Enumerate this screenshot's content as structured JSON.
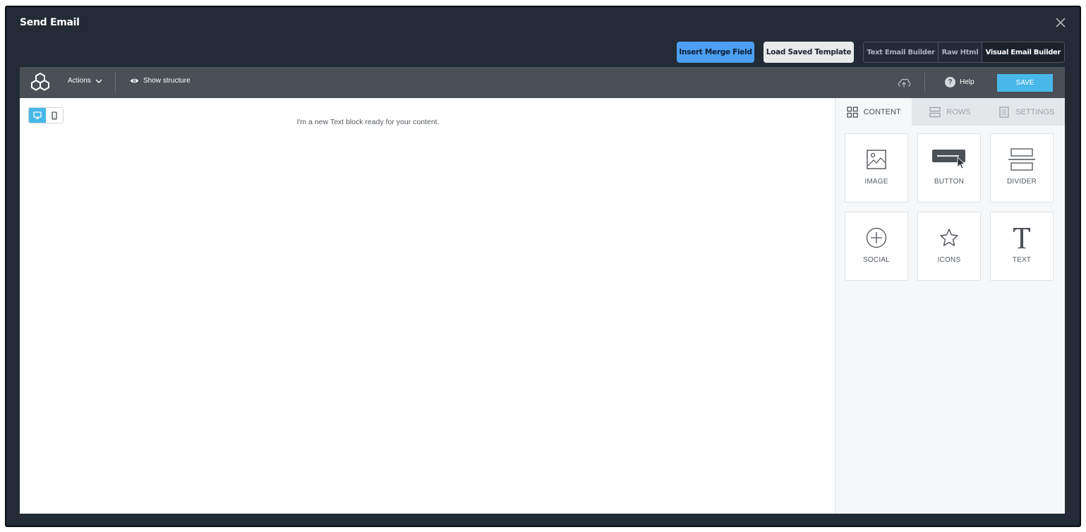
{
  "modal": {
    "title": "Send Email",
    "close_icon": "close-icon"
  },
  "header_actions": {
    "insert_merge_field": "Insert Merge Field",
    "load_saved_template": "Load Saved Template",
    "editor_modes": [
      {
        "label": "Text Email Builder",
        "active": false
      },
      {
        "label": "Raw Html",
        "active": false
      },
      {
        "label": "Visual Email Builder",
        "active": true
      }
    ]
  },
  "builder_toolbar": {
    "logo_icon": "cubes-logo-icon",
    "actions_label": "Actions",
    "show_structure_label": "Show structure",
    "upload_icon": "cloud-upload-icon",
    "help_label": "Help",
    "save_label": "SAVE"
  },
  "canvas": {
    "device_toggle": {
      "desktop_icon": "desktop-icon",
      "mobile_icon": "mobile-icon",
      "active": "desktop"
    },
    "text_block": "I'm a new Text block ready for your content."
  },
  "side_panel": {
    "tabs": [
      {
        "label": "CONTENT",
        "icon": "grid-icon",
        "active": true
      },
      {
        "label": "ROWS",
        "icon": "rows-icon",
        "active": false
      },
      {
        "label": "SETTINGS",
        "icon": "settings-doc-icon",
        "active": false
      }
    ],
    "content_blocks": [
      {
        "label": "IMAGE",
        "icon": "image-icon"
      },
      {
        "label": "BUTTON",
        "icon": "button-icon"
      },
      {
        "label": "DIVIDER",
        "icon": "divider-icon"
      },
      {
        "label": "SOCIAL",
        "icon": "plus-circle-icon"
      },
      {
        "label": "ICONS",
        "icon": "star-icon"
      },
      {
        "label": "TEXT",
        "icon": "text-icon"
      }
    ]
  },
  "colors": {
    "modal_background": "#232b36",
    "primary_blue": "#4c9ff2",
    "save_blue": "#48b8ea",
    "toolbar_gray": "#4a5055"
  }
}
